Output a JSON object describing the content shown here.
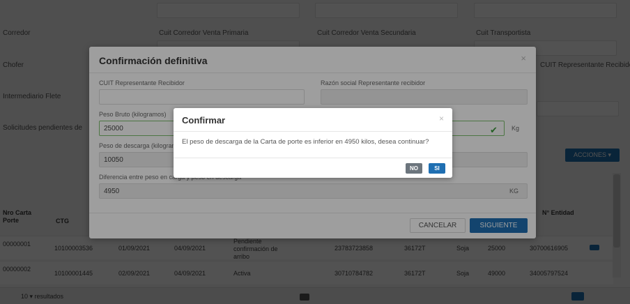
{
  "background": {
    "labels": [
      "Corredor",
      "Cuit Corredor Venta Primaria",
      "Cuit Corredor Venta Secundaria",
      "Cuit Transportista",
      "Chofer",
      "CUIT Representante Recibidor",
      "Intermediario Flete",
      "Solicitudes pendientes de"
    ],
    "actions_button": "ACCIONES ▾",
    "columns": [
      "Nro Carta Porte",
      "CTG",
      "N° Entidad"
    ],
    "rows": [
      [
        "00000001",
        "10100003536",
        "01/09/2021",
        "04/09/2021",
        "Pendiente confirmación de arribo",
        "23783723858",
        "36172T",
        "Soja",
        "25000",
        "30700616905"
      ],
      [
        "00000002",
        "10100001445",
        "02/09/2021",
        "04/09/2021",
        "Activa",
        "30710784782",
        "36172T",
        "Soja",
        "49000",
        "34005797524"
      ]
    ],
    "footer_text": "10 ▾ resultados"
  },
  "modal_confirmacion": {
    "title": "Confirmación definitiva",
    "close": "×",
    "cuit_label": "CUIT Representante Recibidor",
    "razon_label": "Razón social Representante recibidor",
    "peso_bruto_label": "Peso Bruto (kilogramos)",
    "peso_bruto_value": "25000",
    "peso_descarga_label": "Peso de descarga (kilogramos)",
    "peso_descarga_value": "10050",
    "diferencia_label": "Diferencia entre peso en carga y peso en descarga",
    "diferencia_value": "4950",
    "unit_kg": "Kg",
    "unit_kg_caps": "KG",
    "cancel": "CANCELAR",
    "next": "SIGUIENTE"
  },
  "modal_confirmar": {
    "title": "Confirmar",
    "close": "×",
    "message": "El peso de descarga de la Carta de porte es inferior en 4950 kilos, desea continuar?",
    "no": "NO",
    "si": "SI"
  }
}
